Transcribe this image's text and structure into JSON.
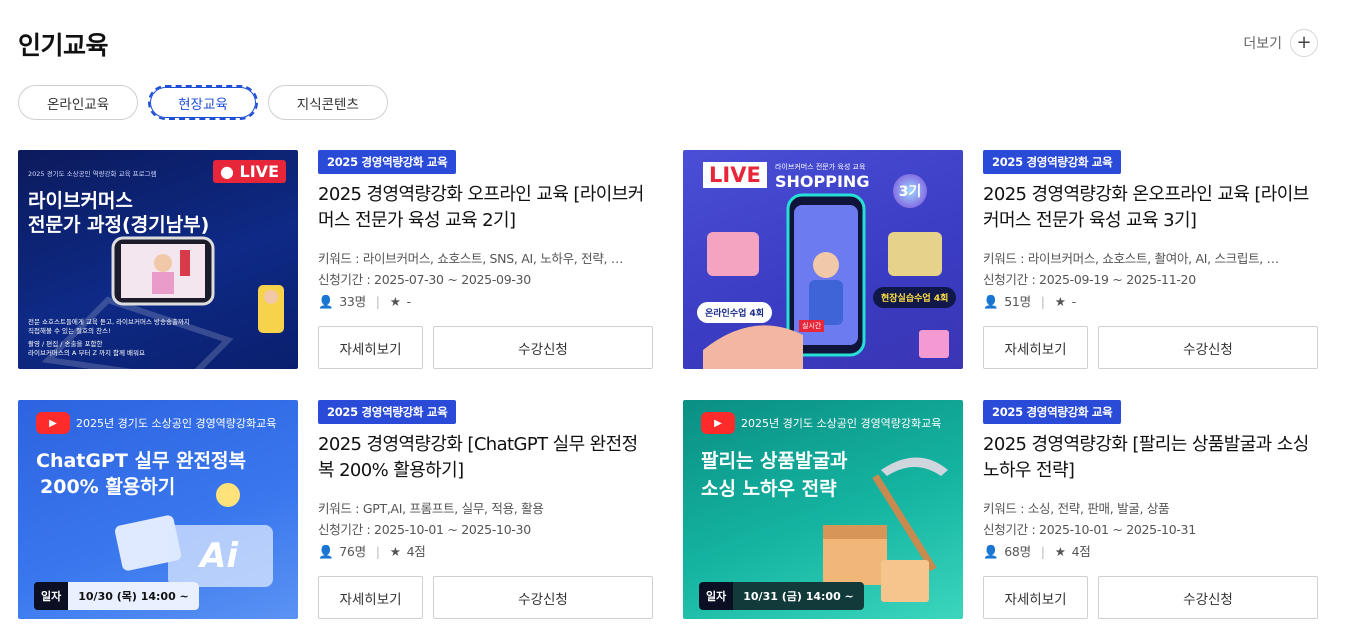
{
  "header": {
    "title": "인기교육",
    "more_label": "더보기",
    "more_icon": "plus-icon"
  },
  "tabs": [
    {
      "label": "온라인교육",
      "active": false
    },
    {
      "label": "현장교육",
      "active": true
    },
    {
      "label": "지식콘텐츠",
      "active": false
    }
  ],
  "cards": [
    {
      "badge": "2025 경영역량강화 교육",
      "title": "2025 경영역량강화 오프라인 교육 [라이브커머스 전문가 육성 교육 2기]",
      "keywords": "키워드 : 라이브커머스, 쇼호스트, SNS, AI, 노하우, 전략, …",
      "period": "신청기간 : 2025-07-30 ~ 2025-09-30",
      "people": "33명",
      "rating": "-",
      "detail_label": "자세히보기",
      "apply_label": "수강신청",
      "thumb": {
        "top": "2025 경기도 소상공인 역량강화 교육 프로그램",
        "live": "LIVE",
        "line1": "라이브커머스",
        "line2": "전문가 과정(경기남부)",
        "desc1": "전문 쇼호스트들에게 교육 듣고, 라이브커머스 방송송출까지",
        "desc2": "직접해볼 수 있는 절호의 찬스!",
        "desc3": "촬영 / 편집 / 송출을 포함한",
        "desc4": "라이브커머스의 A 부터 Z 까지 함께 배워요"
      }
    },
    {
      "badge": "2025 경영역량강화 교육",
      "title": "2025 경영역량강화 온오프라인 교육 [라이브커머스 전문가 육성 교육 3기]",
      "keywords": "키워드 : 라이브커머스, 쇼호스트, 촬여아, AI, 스크립트, …",
      "period": "신청기간 : 2025-09-19 ~ 2025-11-20",
      "people": "51명",
      "rating": "-",
      "detail_label": "자세히보기",
      "apply_label": "수강신청",
      "thumb": {
        "live": "LIVE",
        "shopping": "SHOPPING",
        "sub": "라이브커머스 전문가 육성 교육",
        "gen": "3기",
        "online": "온라인수업 4회",
        "field": "현장실습수업 4회",
        "realtime": "실시간"
      }
    },
    {
      "badge": "2025 경영역량강화 교육",
      "title": "2025 경영역량강화 [ChatGPT 실무 완전정복 200% 활용하기]",
      "keywords": "키워드 : GPT,AI, 프롬프트, 실무, 적용, 활용",
      "period": "신청기간 : 2025-10-01 ~ 2025-10-30",
      "people": "76명",
      "rating": "4점",
      "detail_label": "자세히보기",
      "apply_label": "수강신청",
      "thumb": {
        "top": "2025년 경기도 소상공인 경영역량강화교육",
        "line1": "ChatGPT 실무 완전정복",
        "line2": "200% 활용하기",
        "ai": "Ai",
        "date_label": "일자",
        "date": "10/30 (목) 14:00 ~"
      }
    },
    {
      "badge": "2025 경영역량강화 교육",
      "title": "2025 경영역량강화 [팔리는 상품발굴과 소싱 노하우 전략]",
      "keywords": "키워드 : 소싱, 전략, 판매, 발굴, 상품",
      "period": "신청기간 : 2025-10-01 ~ 2025-10-31",
      "people": "68명",
      "rating": "4점",
      "detail_label": "자세히보기",
      "apply_label": "수강신청",
      "thumb": {
        "top": "2025년 경기도 소상공인 경영역량강화교육",
        "line1": "팔리는 상품발굴과",
        "line2": "소싱 노하우 전략",
        "date_label": "일자",
        "date": "10/31 (금) 14:00 ~"
      }
    }
  ],
  "colors": {
    "accent": "#2a4bd8",
    "tab_active": "#1f4fd6"
  }
}
